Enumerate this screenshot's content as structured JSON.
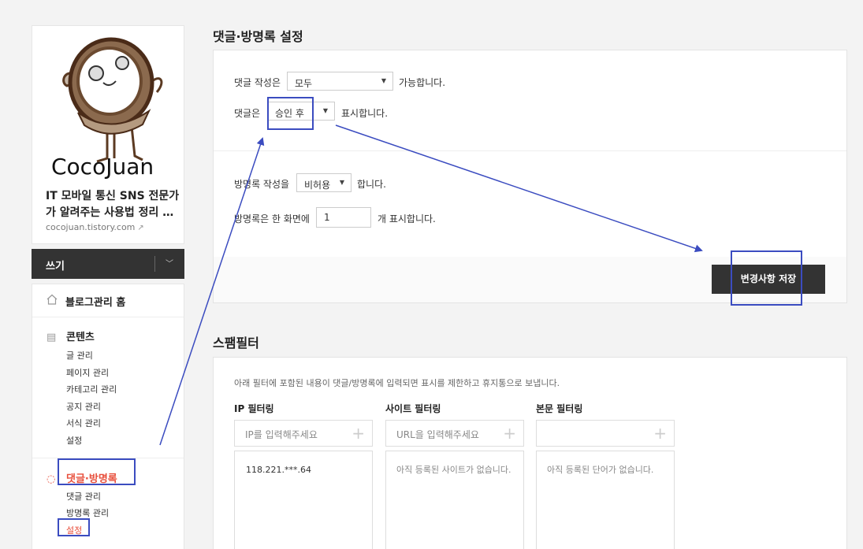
{
  "sidebar": {
    "blog_title_line1": "IT 모바일 통신 SNS 전문가",
    "blog_title_line2": "가 알려주는 사용법 정리 …",
    "blog_url": "cocojuan.tistory.com",
    "avatar_text": "CocoJuan",
    "write_label": "쓰기",
    "home_label": "블로그관리 홈",
    "contents": {
      "label": "콘텐츠",
      "items": [
        "글 관리",
        "페이지 관리",
        "카테고리 관리",
        "공지 관리",
        "서식 관리",
        "설정"
      ]
    },
    "comments": {
      "label": "댓글·방명록",
      "items": [
        "댓글 관리",
        "방명록 관리",
        "설정"
      ]
    }
  },
  "settings": {
    "title": "댓글·방명록 설정",
    "comment_write_prefix": "댓글 작성은",
    "comment_write_value": "모두",
    "comment_write_suffix": "가능합니다.",
    "comment_show_prefix": "댓글은",
    "comment_show_value": "승인 후",
    "comment_show_suffix": "표시합니다.",
    "guestbook_write_prefix": "방명록 작성을",
    "guestbook_write_value": "비허용",
    "guestbook_write_suffix": "합니다.",
    "guestbook_count_prefix": "방명록은 한 화면에",
    "guestbook_count_value": "1",
    "guestbook_count_suffix": "개 표시합니다.",
    "save_label": "변경사항 저장"
  },
  "spam": {
    "title": "스팸필터",
    "description": "아래 필터에 포함된 내용이 댓글/방명록에 입력되면 표시를 제한하고 휴지통으로 보냅니다.",
    "ip": {
      "title": "IP 필터링",
      "placeholder": "IP를 입력해주세요",
      "entries": [
        "118.221.***.64"
      ]
    },
    "site": {
      "title": "사이트 필터링",
      "placeholder": "URL을 입력해주세요",
      "empty": "아직 등록된 사이트가 없습니다."
    },
    "body": {
      "title": "본문 필터링",
      "placeholder": "",
      "empty": "아직 등록된 단어가 없습니다."
    }
  },
  "colors": {
    "accent": "#e84f3c",
    "dark_button": "#333333",
    "annotation": "#3b4cc0"
  },
  "icons": [
    "home-icon",
    "document-icon",
    "comment-icon",
    "chevron-down-icon",
    "external-link-icon",
    "plus-icon"
  ]
}
